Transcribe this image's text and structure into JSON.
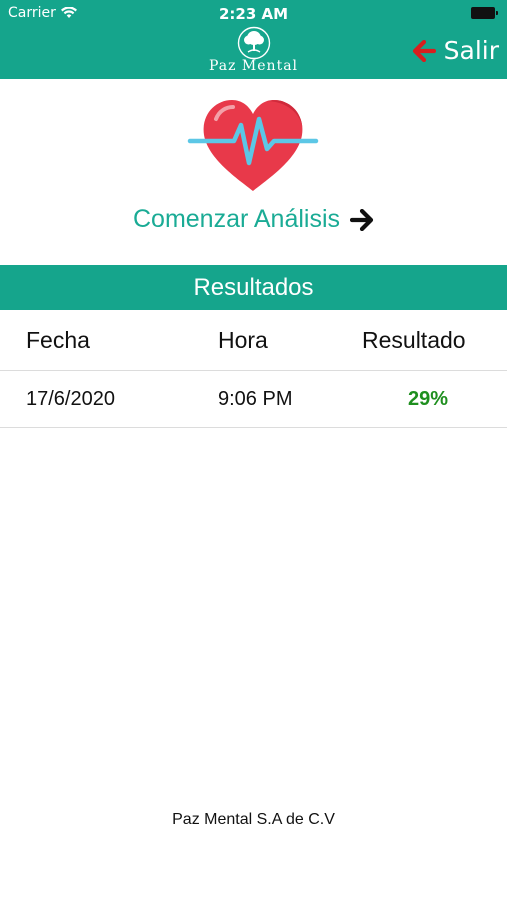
{
  "status_bar": {
    "carrier": "Carrier",
    "time": "2:23 AM",
    "wifi_icon": "wifi-icon",
    "battery_icon": "battery-icon"
  },
  "header": {
    "logo_icon": "tree-logo-icon",
    "logo_text": "Paz Mental",
    "exit_label": "Salir",
    "exit_icon": "arrow-left-icon",
    "background_color": "#15a58c",
    "exit_icon_color": "#d81e1e"
  },
  "analysis": {
    "heart_icon": "heart-pulse-icon",
    "start_label": "Comenzar Análisis",
    "start_icon": "arrow-right-icon",
    "label_color": "#1aab95"
  },
  "results": {
    "title": "Resultados",
    "columns": [
      "Fecha",
      "Hora",
      "Resultado"
    ],
    "rows": [
      {
        "fecha": "17/6/2020",
        "hora": "9:06 PM",
        "resultado": "29%"
      }
    ],
    "result_color": "#1f8f1f"
  },
  "footer": {
    "text": "Paz Mental S.A de C.V"
  }
}
